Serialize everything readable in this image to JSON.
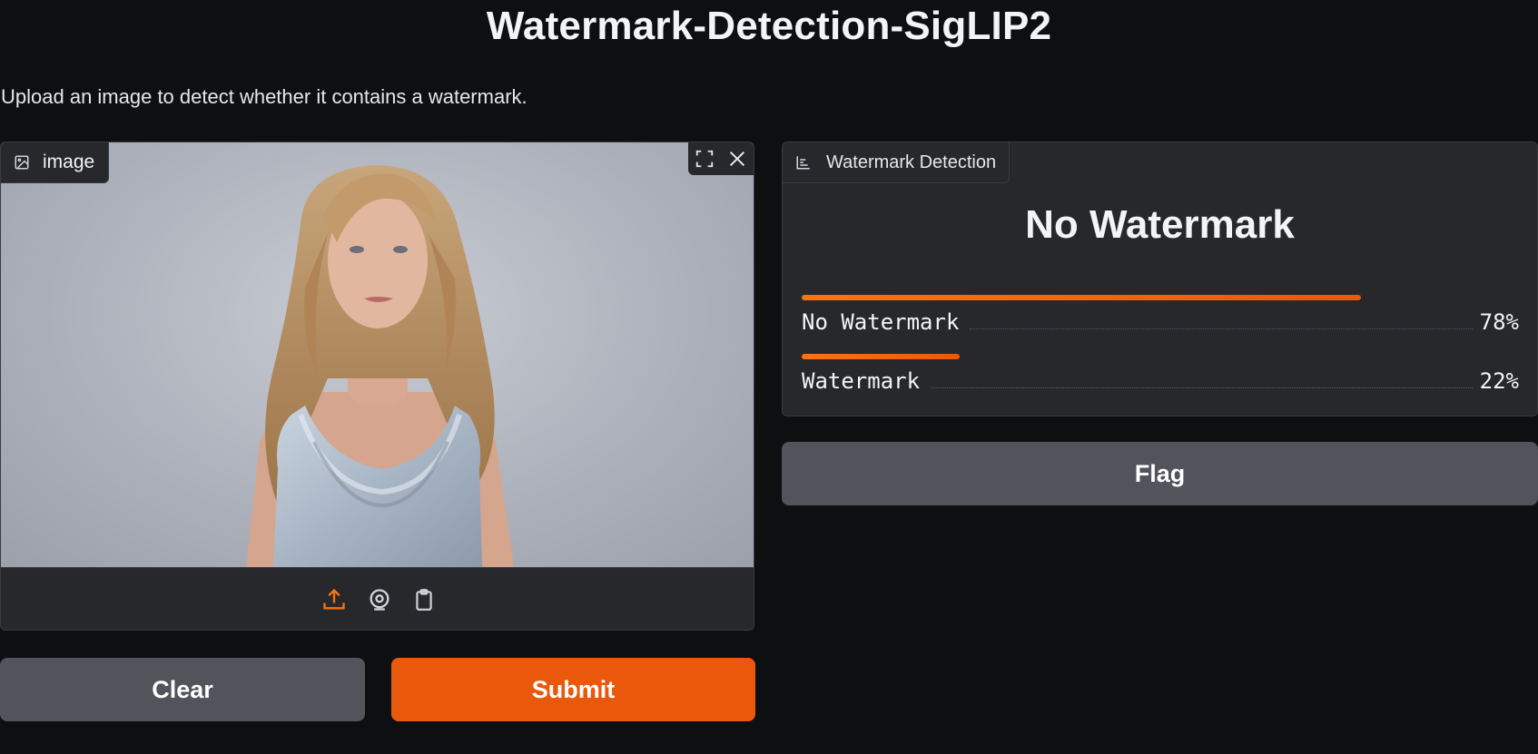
{
  "app": {
    "title": "Watermark-Detection-SigLIP2",
    "description": "Upload an image to detect whether it contains a watermark."
  },
  "image_input": {
    "label": "image",
    "icons": {
      "label_icon": "image-icon",
      "fullscreen": "fullscreen-icon",
      "clear": "close-icon",
      "upload": "upload-icon",
      "webcam": "webcam-icon",
      "clipboard": "clipboard-icon"
    }
  },
  "output": {
    "label": "Watermark Detection",
    "label_icon": "bar-chart-icon",
    "top_label": "No Watermark",
    "confidences": [
      {
        "label": "No Watermark",
        "value": 0.78,
        "text": "78%"
      },
      {
        "label": "Watermark",
        "value": 0.22,
        "text": "22%"
      }
    ]
  },
  "buttons": {
    "clear": "Clear",
    "submit": "Submit",
    "flag": "Flag"
  },
  "colors": {
    "accent": "#ea580c",
    "background": "#0e0f11",
    "panel": "#27282c",
    "secondary_button": "#52535b"
  }
}
